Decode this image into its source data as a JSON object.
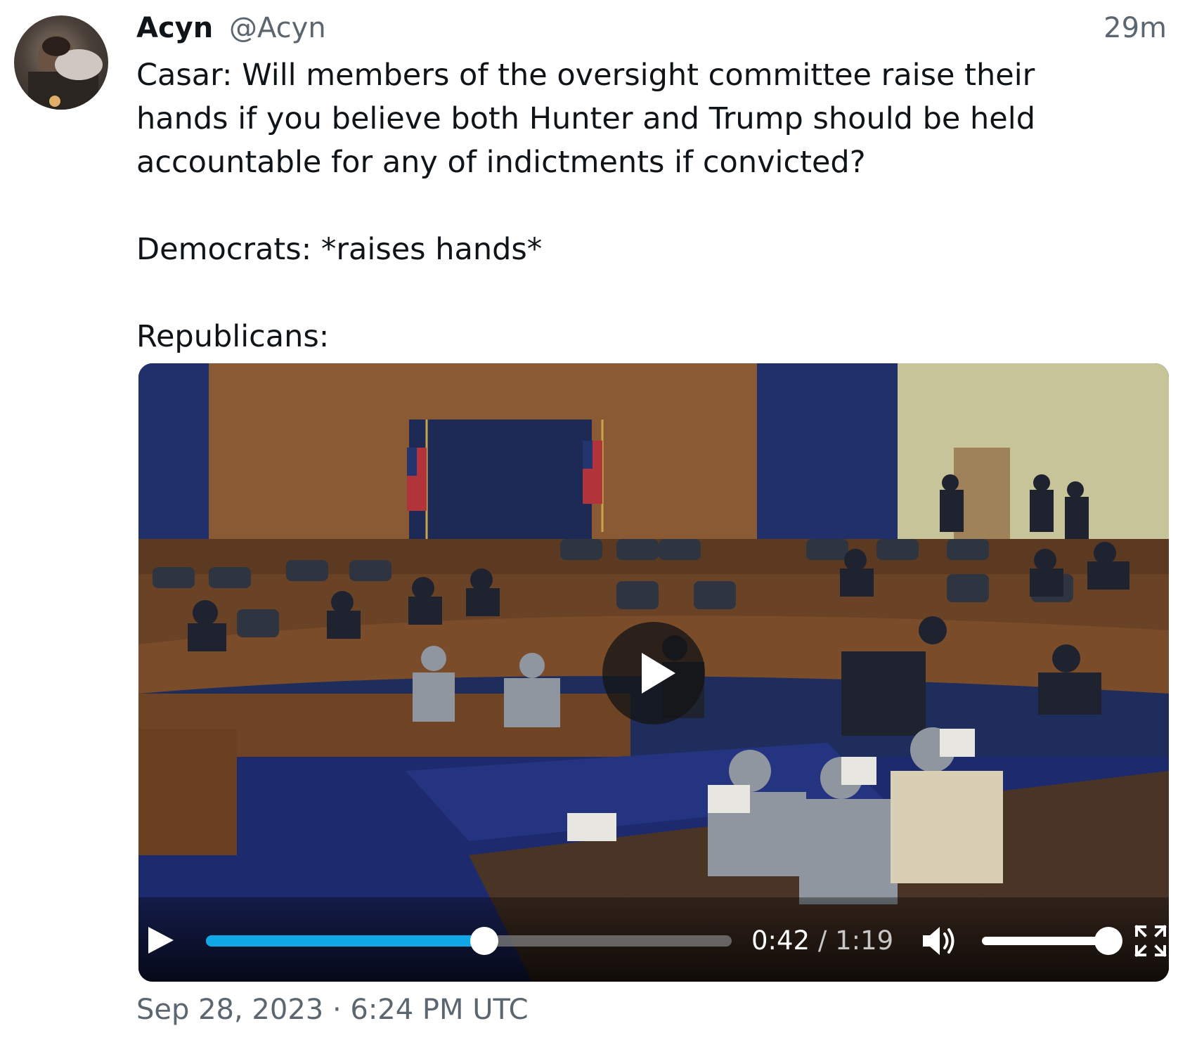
{
  "tweet": {
    "author_name": "Acyn",
    "author_handle": "@Acyn",
    "relative_time": "29m",
    "text": "Casar: Will members of the oversight committee raise their\nhands if you believe both Hunter and Trump should be held\naccountable for any of indictments if convicted?\n\nDemocrats: *raises hands*\n\nRepublicans:",
    "date": "Sep 28, 2023 · 6:24 PM UTC"
  },
  "video": {
    "current_time": "0:42",
    "separator": " / ",
    "duration": "1:19",
    "progress_fraction": 0.53,
    "volume_fraction": 1.0,
    "accent_color": "#10a8e6",
    "icons": [
      "play-icon",
      "volume-icon",
      "fullscreen-icon",
      "big-play-icon"
    ]
  }
}
